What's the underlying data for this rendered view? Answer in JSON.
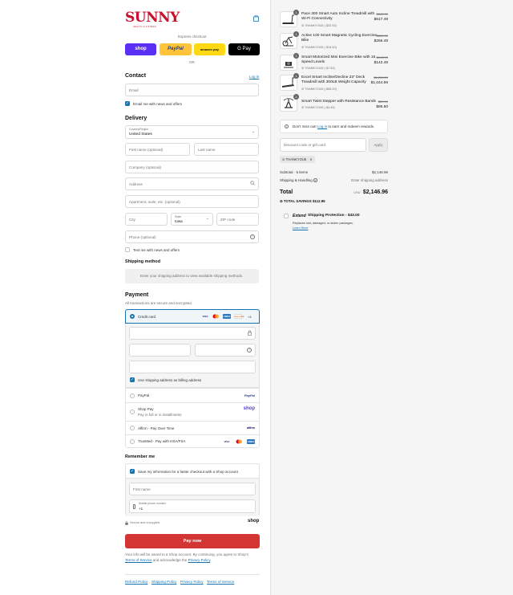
{
  "brand": {
    "name": "SUNNY",
    "tagline": "HEALTH & FITNESS"
  },
  "express": {
    "label": "Express checkout",
    "shop": "shop",
    "paypal": "PayPal",
    "amazon": "amazon pay",
    "gpay": "G Pay",
    "or": "OR"
  },
  "contact": {
    "heading": "Contact",
    "login": "Log in",
    "email_placeholder": "Email",
    "news": "Email me with news and offers"
  },
  "delivery": {
    "heading": "Delivery",
    "country_label": "Country/Region",
    "country_value": "United States",
    "first_name": "First name (optional)",
    "last_name": "Last name",
    "company": "Company (optional)",
    "address": "Address",
    "apartment": "Apartment, suite, etc. (optional)",
    "city": "City",
    "state_label": "State",
    "state_value": "Iowa",
    "zip": "ZIP code",
    "phone": "Phone (optional)",
    "text_me": "Text me with news and offers"
  },
  "shipping": {
    "heading": "Shipping method",
    "note": "Enter your shipping address to view available shipping methods."
  },
  "payment": {
    "heading": "Payment",
    "sub": "All transactions are secure and encrypted.",
    "credit_card": "Credit card",
    "more_cards": "+4",
    "billing": "Use shipping address as billing address",
    "paypal": "PayPal",
    "paypal_logo": "PayPal",
    "shoppay": "Shop Pay",
    "shoppay_sub": "Pay in full or in installments",
    "shoppay_logo": "shop",
    "affirm": "Affirm - Pay Over Time",
    "affirm_logo": "affirm",
    "truemed": "TrueMed - Pay with HSA/FSA",
    "card_logos": [
      "VISA",
      "MC",
      "AMEX",
      "DISCOVER"
    ]
  },
  "remember": {
    "heading": "Remember me",
    "save": "Save my information for a faster checkout with a Shop account",
    "first_name": "First name",
    "mobile_label": "Mobile phone number",
    "mobile_value": "+1",
    "secure": "Secure and encrypted",
    "shop": "shop"
  },
  "pay": {
    "button": "Pay now",
    "legal1": "Your info will be saved to a Shop account. By continuing, you agree to Shop's",
    "terms": "Terms of Service",
    "and": "and acknowledge the",
    "privacy": "Privacy Policy",
    "period": "."
  },
  "footer": {
    "refund": "Refund Policy",
    "shipping": "Shipping Policy",
    "privacy": "Privacy Policy",
    "terms": "Terms of Service"
  },
  "cart": {
    "items": [
      {
        "qty": "1",
        "title": "Pace 300 Smart Auto Incline Treadmill with Wi-Fi Connectivity",
        "discount": "THANKYOU5 (-$32.50)",
        "old": "$649.99",
        "price": "$617.49"
      },
      {
        "qty": "1",
        "title": "Active 100 Smart Magnetic Cycling Exercise Bike",
        "discount": "THANKYOU5 (-$13.50)",
        "old": "$269.99",
        "price": "$256.49"
      },
      {
        "qty": "1",
        "title": "Smart Motorized Mini Exercise Bike with 16 Speed Levels",
        "discount": "THANKYOU5 (-$7.50)",
        "old": "$149.99",
        "price": "$142.49"
      },
      {
        "qty": "1",
        "title": "Excel Smart Incline/Decline 23\" Deck Treadmill with 300LB Weight Capacity",
        "discount": "THANKYOU5 (-$55.00)",
        "old": "$1,099.99",
        "price": "$1,044.99"
      },
      {
        "qty": "1",
        "title": "Smart Twist Stepper with Resistance Bands",
        "discount": "THANKYOU5 (-$4.49)",
        "old": "$89.99",
        "price": "$85.50"
      }
    ],
    "rewards": "Don't miss out!",
    "rewards_link": "Log in",
    "rewards_rest": "to earn and redeem rewards.",
    "code_placeholder": "Discount code or gift card",
    "apply": "Apply",
    "tag": "THANKYOU5",
    "subtotal_label": "Subtotal · 5 items",
    "subtotal": "$2,146.96",
    "shipping_label": "Shipping & Handling",
    "shipping_value": "Enter shipping address",
    "total_label": "Total",
    "currency": "USD",
    "total": "$2,146.96",
    "savings_label": "TOTAL SAVINGS",
    "savings": "$112.99",
    "extend_brand": "Extend",
    "extend_title": "Shipping Protection - $43.00",
    "extend_desc": "Replaces lost, damaged, or stolen packages.",
    "learn_more": "Learn More"
  }
}
